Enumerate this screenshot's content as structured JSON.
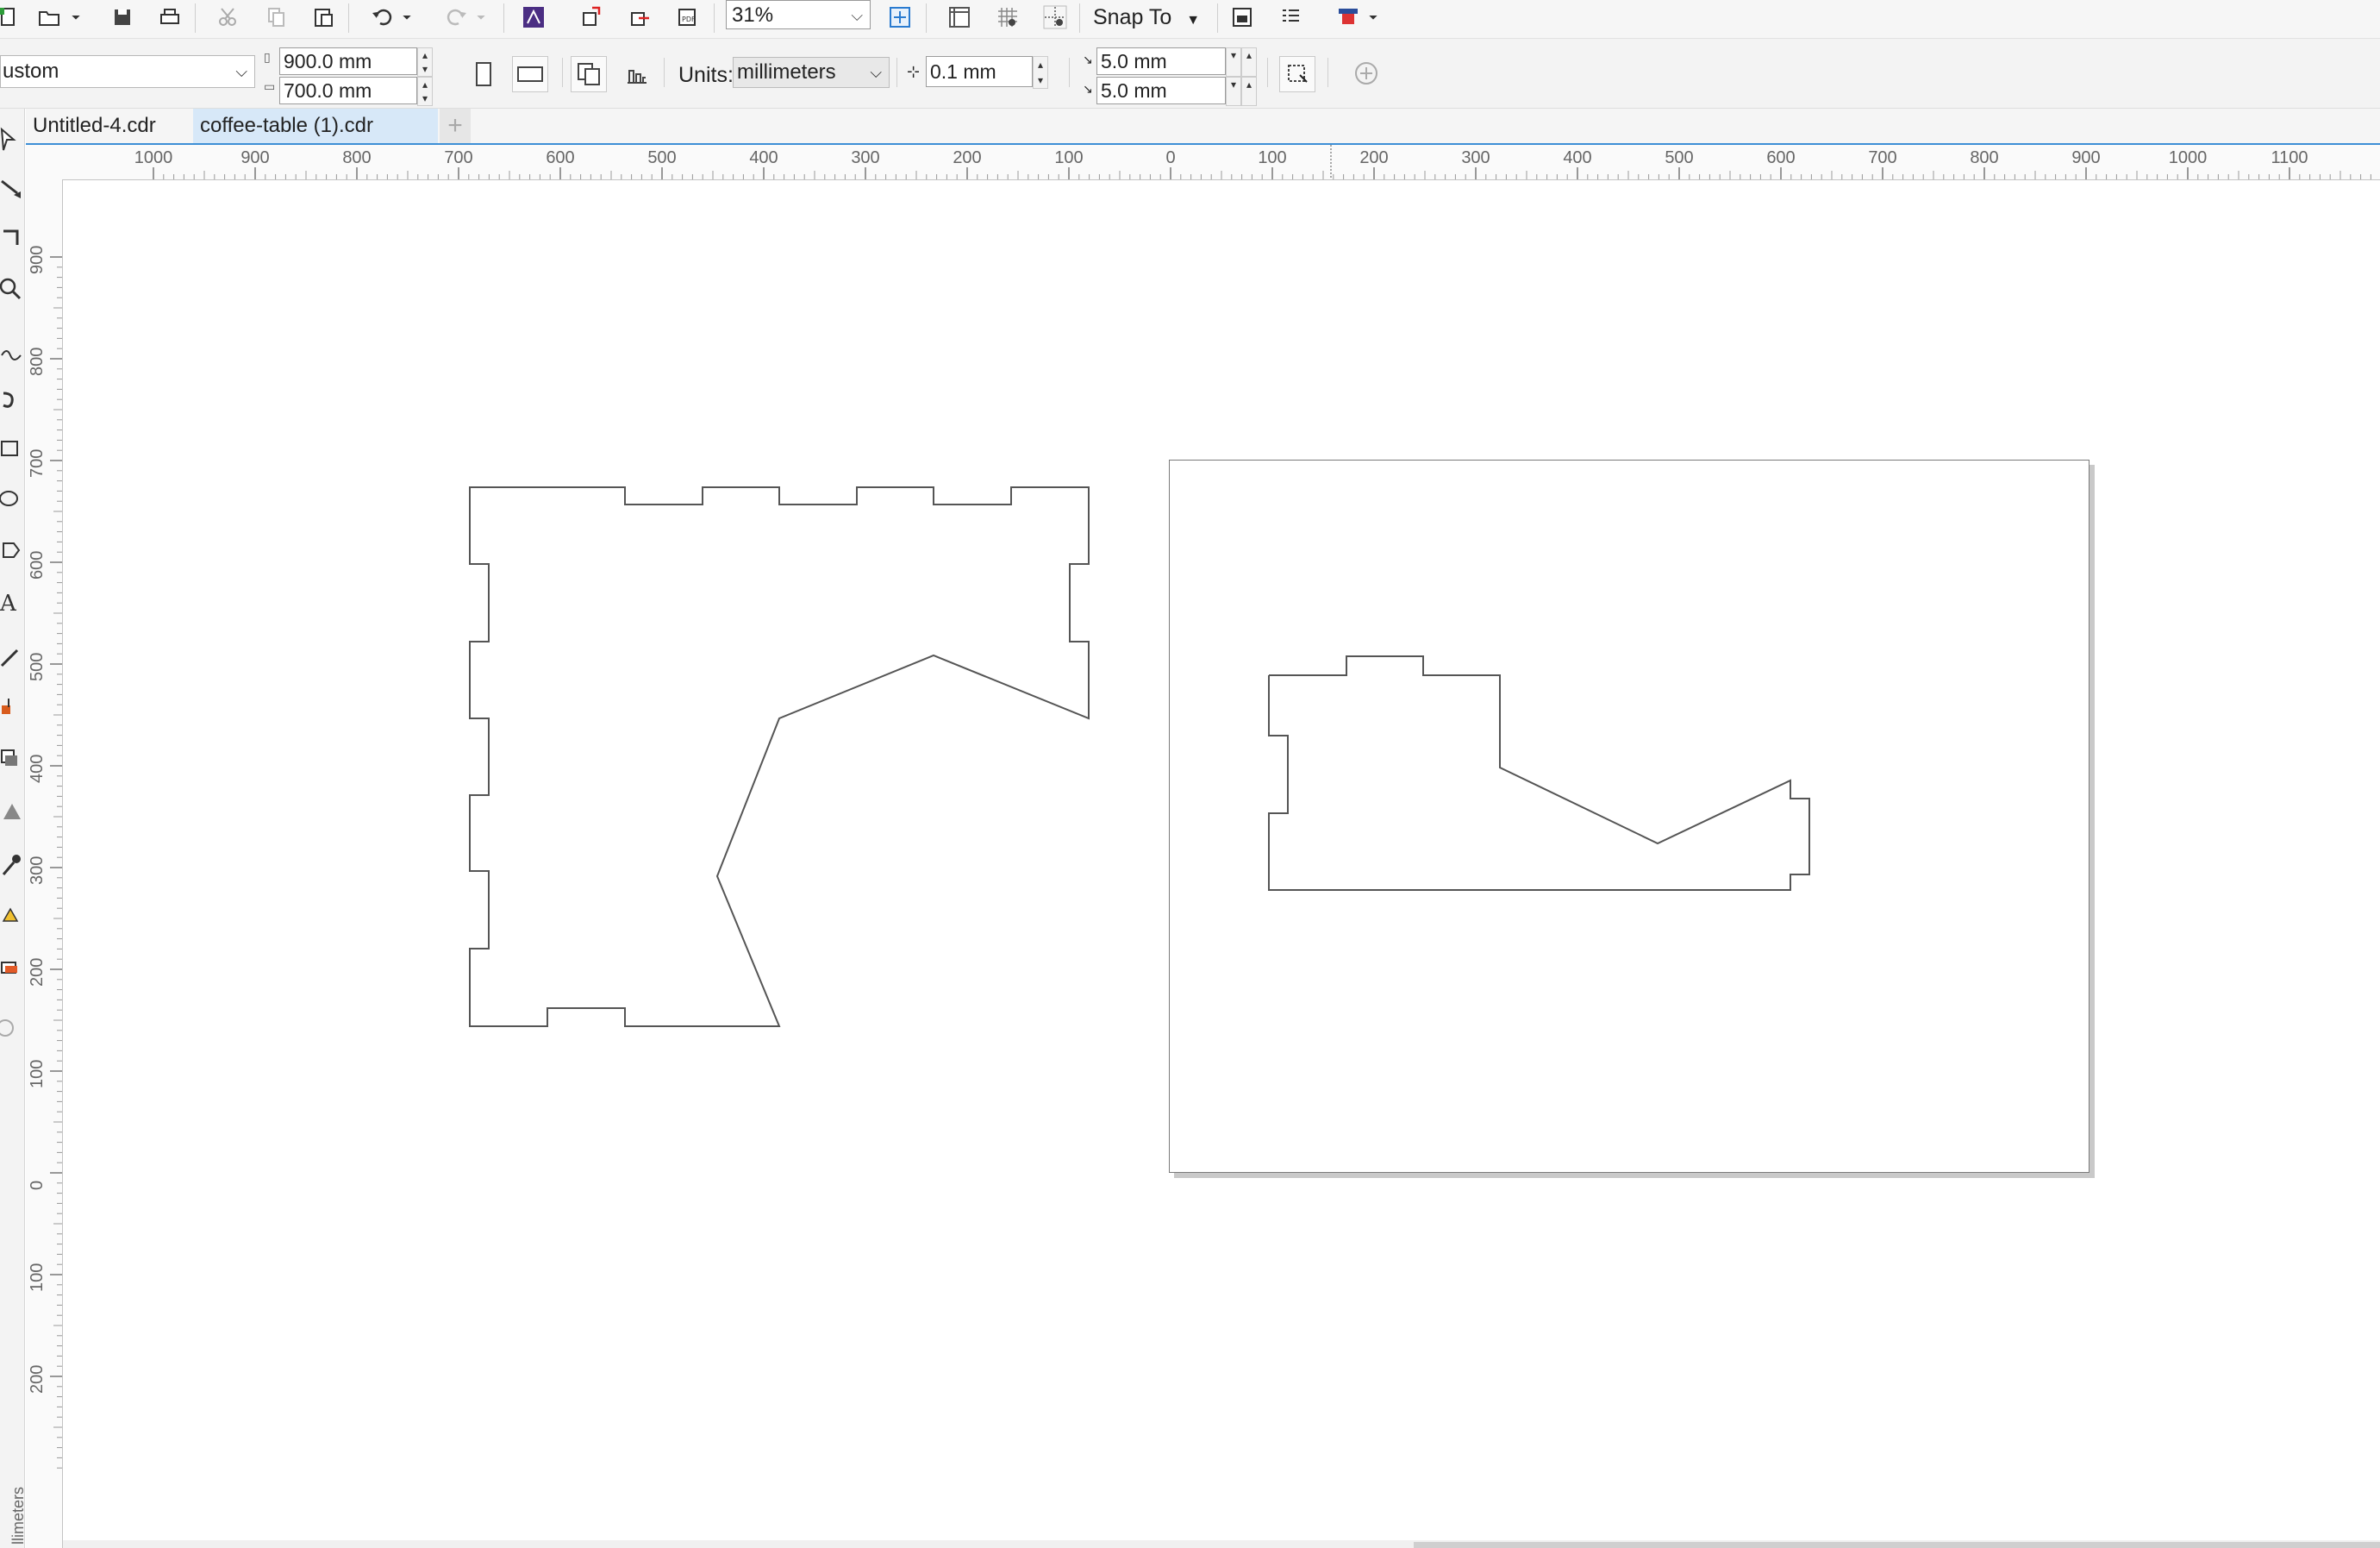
{
  "toolbar": {
    "zoom": "31%",
    "snap_to": "Snap To",
    "icons": [
      "new-icon",
      "open-icon",
      "save-icon",
      "print-icon",
      "cut-icon",
      "copy-icon",
      "paste-icon",
      "undo-icon",
      "redo-icon",
      "app-launcher-icon",
      "import-icon",
      "export-icon",
      "publish-pdf-icon",
      "full-screen-preview-icon",
      "rulers-icon",
      "grid-icon",
      "guidelines-icon",
      "options-icon",
      "launch-icon"
    ]
  },
  "property_bar": {
    "page_preset": "ustom",
    "page_width": "900.0 mm",
    "page_height": "700.0 mm",
    "units_label": "Units:",
    "units": "millimeters",
    "nudge": "0.1 mm",
    "dup_x": "5.0 mm",
    "dup_y": "5.0 mm"
  },
  "tabs": [
    {
      "label": "Untitled-4.cdr",
      "active": false
    },
    {
      "label": "coffee-table (1).cdr",
      "active": true
    }
  ],
  "rulers": {
    "horizontal": [
      "1000",
      "900",
      "800",
      "700",
      "600",
      "500",
      "400",
      "300",
      "200",
      "100",
      "0",
      "100",
      "200",
      "300",
      "400",
      "500",
      "600",
      "700",
      "800",
      "900",
      "1000",
      "1100"
    ],
    "vertical": [
      "900",
      "800",
      "700",
      "600",
      "500",
      "400",
      "300",
      "200",
      "100",
      "0",
      "100",
      "200"
    ],
    "units": "llimeters"
  },
  "colors": {
    "accent": "#3d8fd6",
    "tab_active": "#d7e8f8",
    "outline": "#555555"
  }
}
